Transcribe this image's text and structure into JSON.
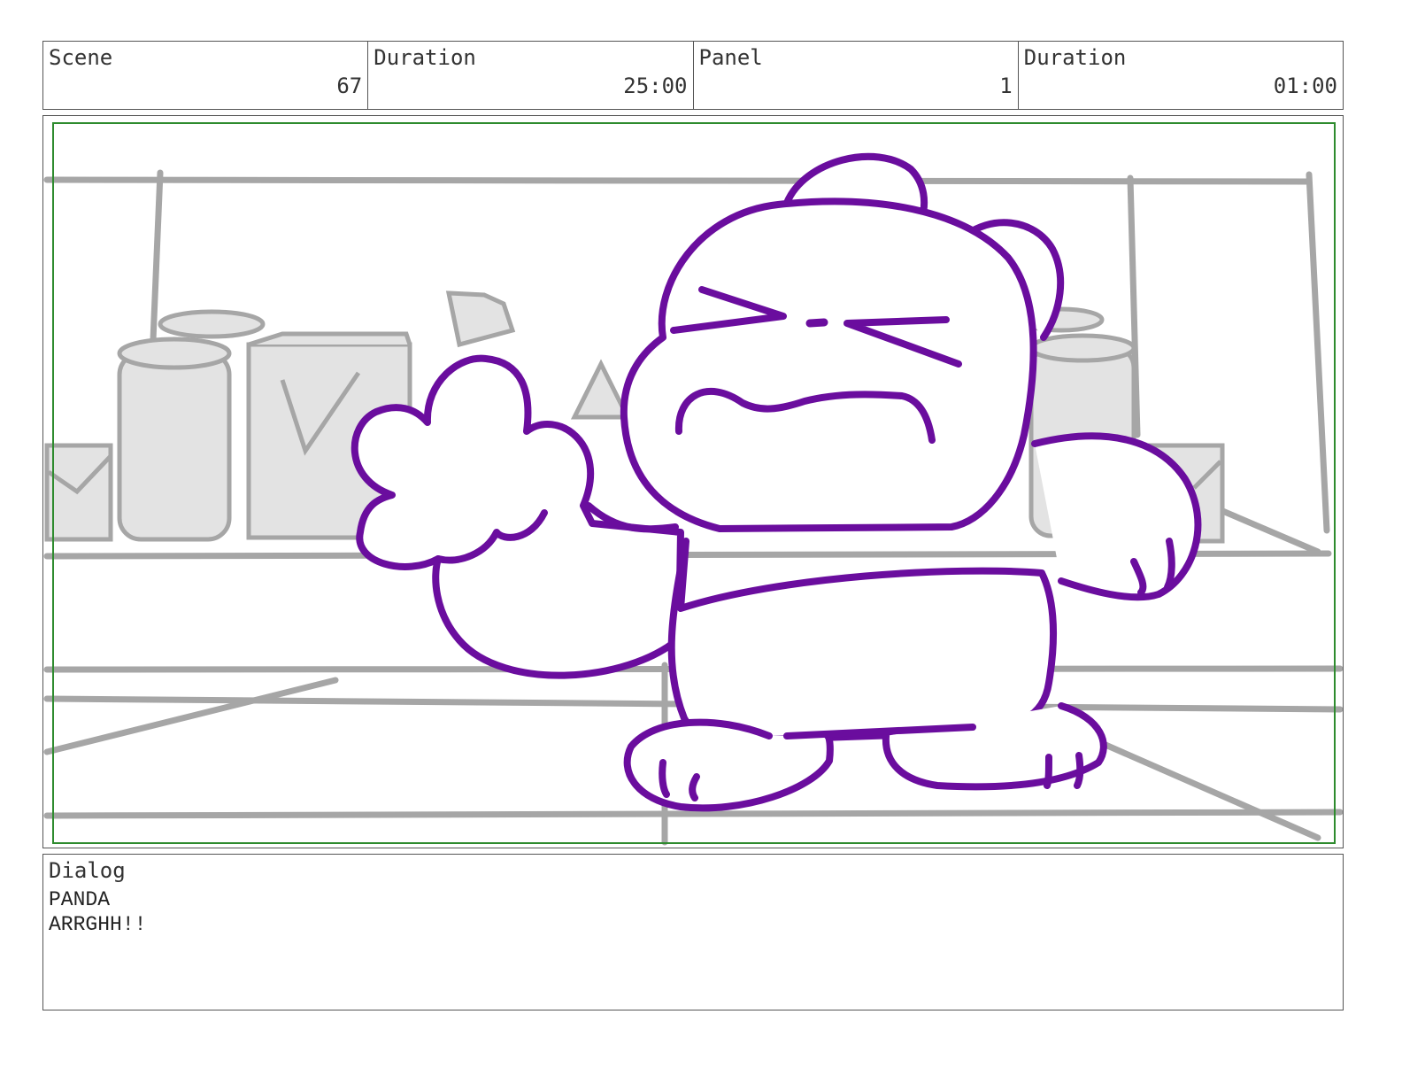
{
  "header": {
    "scene_label": "Scene",
    "scene_value": "67",
    "scene_duration_label": "Duration",
    "scene_duration_value": "25:00",
    "panel_label": "Panel",
    "panel_value": "1",
    "panel_duration_label": "Duration",
    "panel_duration_value": "01:00"
  },
  "colors": {
    "character_line": "#6a0d9e",
    "background_line": "#a6a6a6",
    "background_fill": "#e3e3e3",
    "safe_frame": "#2e8b2e",
    "border": "#555555"
  },
  "dialog": {
    "label": "Dialog",
    "speaker": "PANDA",
    "line": "ARRGHH!!"
  }
}
